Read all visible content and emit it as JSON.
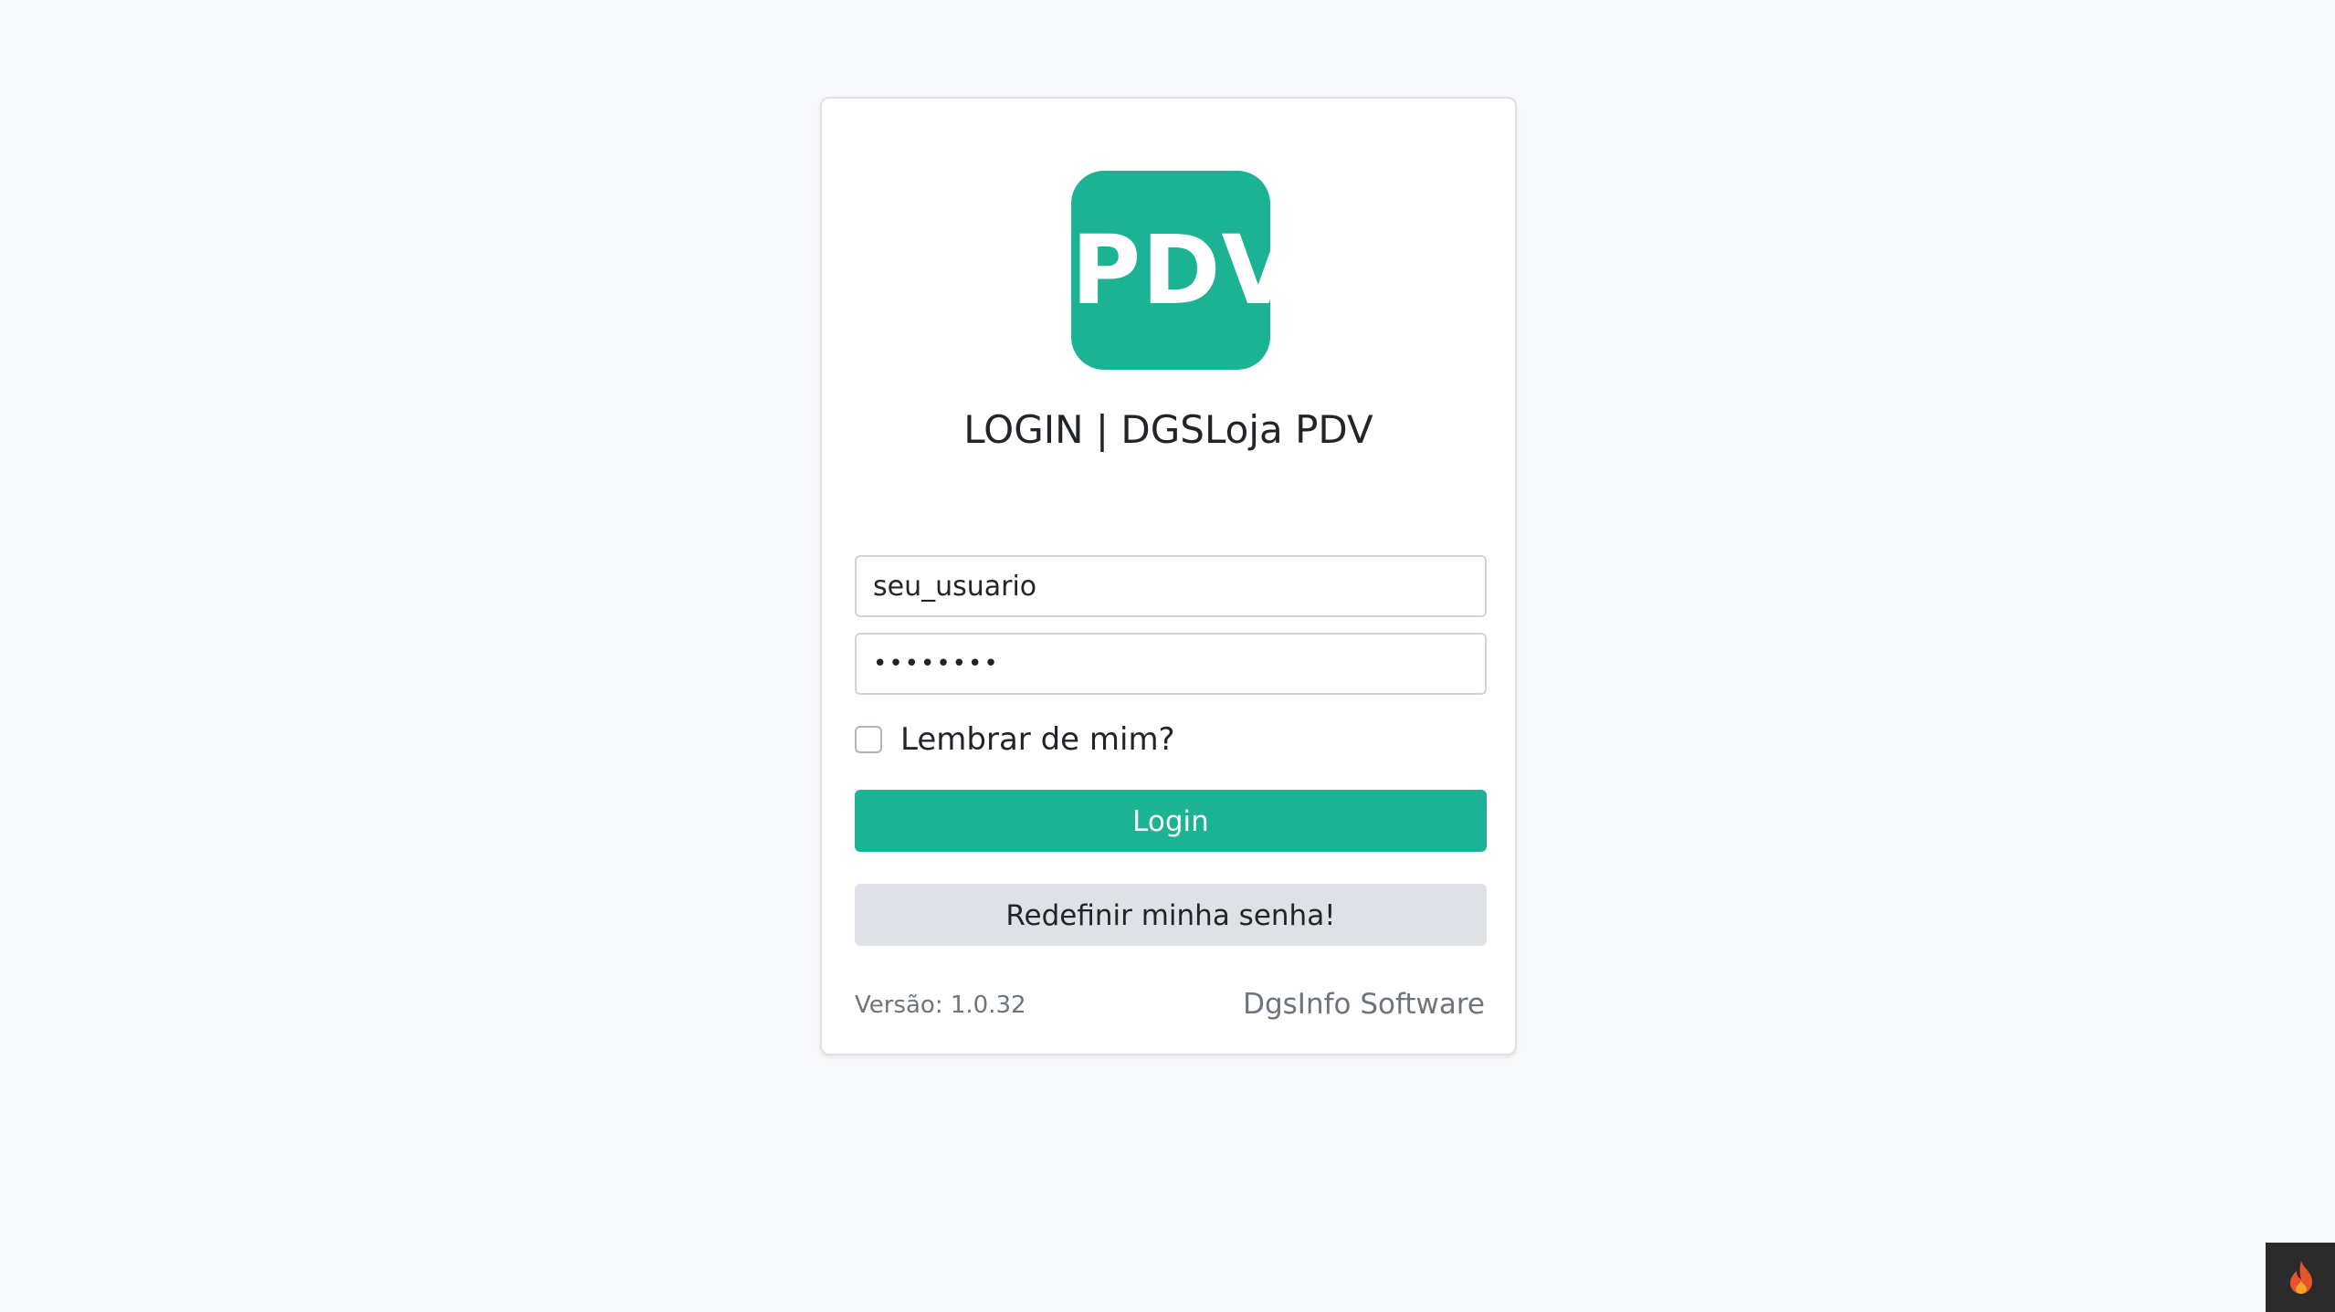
{
  "logo": {
    "text": "PDV",
    "color": "#1bb394"
  },
  "title": "LOGIN | DGSLoja PDV",
  "form": {
    "username_value": "seu_usuario",
    "password_value": "••••••••",
    "remember_label": "Lembrar de mim?",
    "remember_checked": false,
    "login_label": "Login",
    "reset_label": "Redefinir minha senha!"
  },
  "footer": {
    "version": "Versão: 1.0.32",
    "company": "DgsInfo Software"
  },
  "debug_toolbar": {
    "icon": "flame-icon",
    "color": "#e8542a"
  },
  "colors": {
    "accent": "#1bb394",
    "background": "#f8f9fa",
    "secondary_button": "#dee2e6",
    "muted_text": "#6c757d"
  }
}
